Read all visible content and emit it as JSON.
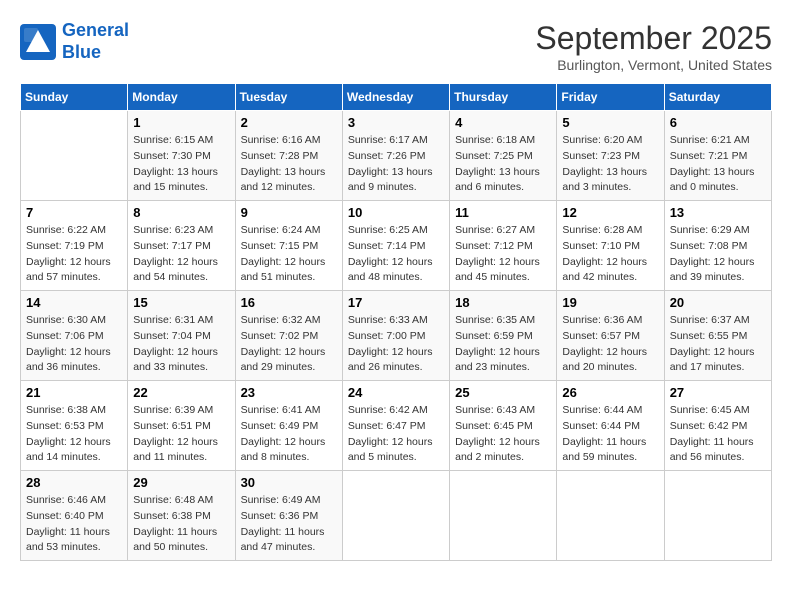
{
  "logo": {
    "line1": "General",
    "line2": "Blue"
  },
  "title": "September 2025",
  "subtitle": "Burlington, Vermont, United States",
  "days_of_week": [
    "Sunday",
    "Monday",
    "Tuesday",
    "Wednesday",
    "Thursday",
    "Friday",
    "Saturday"
  ],
  "weeks": [
    [
      {
        "day": "",
        "sunrise": "",
        "sunset": "",
        "daylight": ""
      },
      {
        "day": "1",
        "sunrise": "Sunrise: 6:15 AM",
        "sunset": "Sunset: 7:30 PM",
        "daylight": "Daylight: 13 hours and 15 minutes."
      },
      {
        "day": "2",
        "sunrise": "Sunrise: 6:16 AM",
        "sunset": "Sunset: 7:28 PM",
        "daylight": "Daylight: 13 hours and 12 minutes."
      },
      {
        "day": "3",
        "sunrise": "Sunrise: 6:17 AM",
        "sunset": "Sunset: 7:26 PM",
        "daylight": "Daylight: 13 hours and 9 minutes."
      },
      {
        "day": "4",
        "sunrise": "Sunrise: 6:18 AM",
        "sunset": "Sunset: 7:25 PM",
        "daylight": "Daylight: 13 hours and 6 minutes."
      },
      {
        "day": "5",
        "sunrise": "Sunrise: 6:20 AM",
        "sunset": "Sunset: 7:23 PM",
        "daylight": "Daylight: 13 hours and 3 minutes."
      },
      {
        "day": "6",
        "sunrise": "Sunrise: 6:21 AM",
        "sunset": "Sunset: 7:21 PM",
        "daylight": "Daylight: 13 hours and 0 minutes."
      }
    ],
    [
      {
        "day": "7",
        "sunrise": "Sunrise: 6:22 AM",
        "sunset": "Sunset: 7:19 PM",
        "daylight": "Daylight: 12 hours and 57 minutes."
      },
      {
        "day": "8",
        "sunrise": "Sunrise: 6:23 AM",
        "sunset": "Sunset: 7:17 PM",
        "daylight": "Daylight: 12 hours and 54 minutes."
      },
      {
        "day": "9",
        "sunrise": "Sunrise: 6:24 AM",
        "sunset": "Sunset: 7:15 PM",
        "daylight": "Daylight: 12 hours and 51 minutes."
      },
      {
        "day": "10",
        "sunrise": "Sunrise: 6:25 AM",
        "sunset": "Sunset: 7:14 PM",
        "daylight": "Daylight: 12 hours and 48 minutes."
      },
      {
        "day": "11",
        "sunrise": "Sunrise: 6:27 AM",
        "sunset": "Sunset: 7:12 PM",
        "daylight": "Daylight: 12 hours and 45 minutes."
      },
      {
        "day": "12",
        "sunrise": "Sunrise: 6:28 AM",
        "sunset": "Sunset: 7:10 PM",
        "daylight": "Daylight: 12 hours and 42 minutes."
      },
      {
        "day": "13",
        "sunrise": "Sunrise: 6:29 AM",
        "sunset": "Sunset: 7:08 PM",
        "daylight": "Daylight: 12 hours and 39 minutes."
      }
    ],
    [
      {
        "day": "14",
        "sunrise": "Sunrise: 6:30 AM",
        "sunset": "Sunset: 7:06 PM",
        "daylight": "Daylight: 12 hours and 36 minutes."
      },
      {
        "day": "15",
        "sunrise": "Sunrise: 6:31 AM",
        "sunset": "Sunset: 7:04 PM",
        "daylight": "Daylight: 12 hours and 33 minutes."
      },
      {
        "day": "16",
        "sunrise": "Sunrise: 6:32 AM",
        "sunset": "Sunset: 7:02 PM",
        "daylight": "Daylight: 12 hours and 29 minutes."
      },
      {
        "day": "17",
        "sunrise": "Sunrise: 6:33 AM",
        "sunset": "Sunset: 7:00 PM",
        "daylight": "Daylight: 12 hours and 26 minutes."
      },
      {
        "day": "18",
        "sunrise": "Sunrise: 6:35 AM",
        "sunset": "Sunset: 6:59 PM",
        "daylight": "Daylight: 12 hours and 23 minutes."
      },
      {
        "day": "19",
        "sunrise": "Sunrise: 6:36 AM",
        "sunset": "Sunset: 6:57 PM",
        "daylight": "Daylight: 12 hours and 20 minutes."
      },
      {
        "day": "20",
        "sunrise": "Sunrise: 6:37 AM",
        "sunset": "Sunset: 6:55 PM",
        "daylight": "Daylight: 12 hours and 17 minutes."
      }
    ],
    [
      {
        "day": "21",
        "sunrise": "Sunrise: 6:38 AM",
        "sunset": "Sunset: 6:53 PM",
        "daylight": "Daylight: 12 hours and 14 minutes."
      },
      {
        "day": "22",
        "sunrise": "Sunrise: 6:39 AM",
        "sunset": "Sunset: 6:51 PM",
        "daylight": "Daylight: 12 hours and 11 minutes."
      },
      {
        "day": "23",
        "sunrise": "Sunrise: 6:41 AM",
        "sunset": "Sunset: 6:49 PM",
        "daylight": "Daylight: 12 hours and 8 minutes."
      },
      {
        "day": "24",
        "sunrise": "Sunrise: 6:42 AM",
        "sunset": "Sunset: 6:47 PM",
        "daylight": "Daylight: 12 hours and 5 minutes."
      },
      {
        "day": "25",
        "sunrise": "Sunrise: 6:43 AM",
        "sunset": "Sunset: 6:45 PM",
        "daylight": "Daylight: 12 hours and 2 minutes."
      },
      {
        "day": "26",
        "sunrise": "Sunrise: 6:44 AM",
        "sunset": "Sunset: 6:44 PM",
        "daylight": "Daylight: 11 hours and 59 minutes."
      },
      {
        "day": "27",
        "sunrise": "Sunrise: 6:45 AM",
        "sunset": "Sunset: 6:42 PM",
        "daylight": "Daylight: 11 hours and 56 minutes."
      }
    ],
    [
      {
        "day": "28",
        "sunrise": "Sunrise: 6:46 AM",
        "sunset": "Sunset: 6:40 PM",
        "daylight": "Daylight: 11 hours and 53 minutes."
      },
      {
        "day": "29",
        "sunrise": "Sunrise: 6:48 AM",
        "sunset": "Sunset: 6:38 PM",
        "daylight": "Daylight: 11 hours and 50 minutes."
      },
      {
        "day": "30",
        "sunrise": "Sunrise: 6:49 AM",
        "sunset": "Sunset: 6:36 PM",
        "daylight": "Daylight: 11 hours and 47 minutes."
      },
      {
        "day": "",
        "sunrise": "",
        "sunset": "",
        "daylight": ""
      },
      {
        "day": "",
        "sunrise": "",
        "sunset": "",
        "daylight": ""
      },
      {
        "day": "",
        "sunrise": "",
        "sunset": "",
        "daylight": ""
      },
      {
        "day": "",
        "sunrise": "",
        "sunset": "",
        "daylight": ""
      }
    ]
  ]
}
